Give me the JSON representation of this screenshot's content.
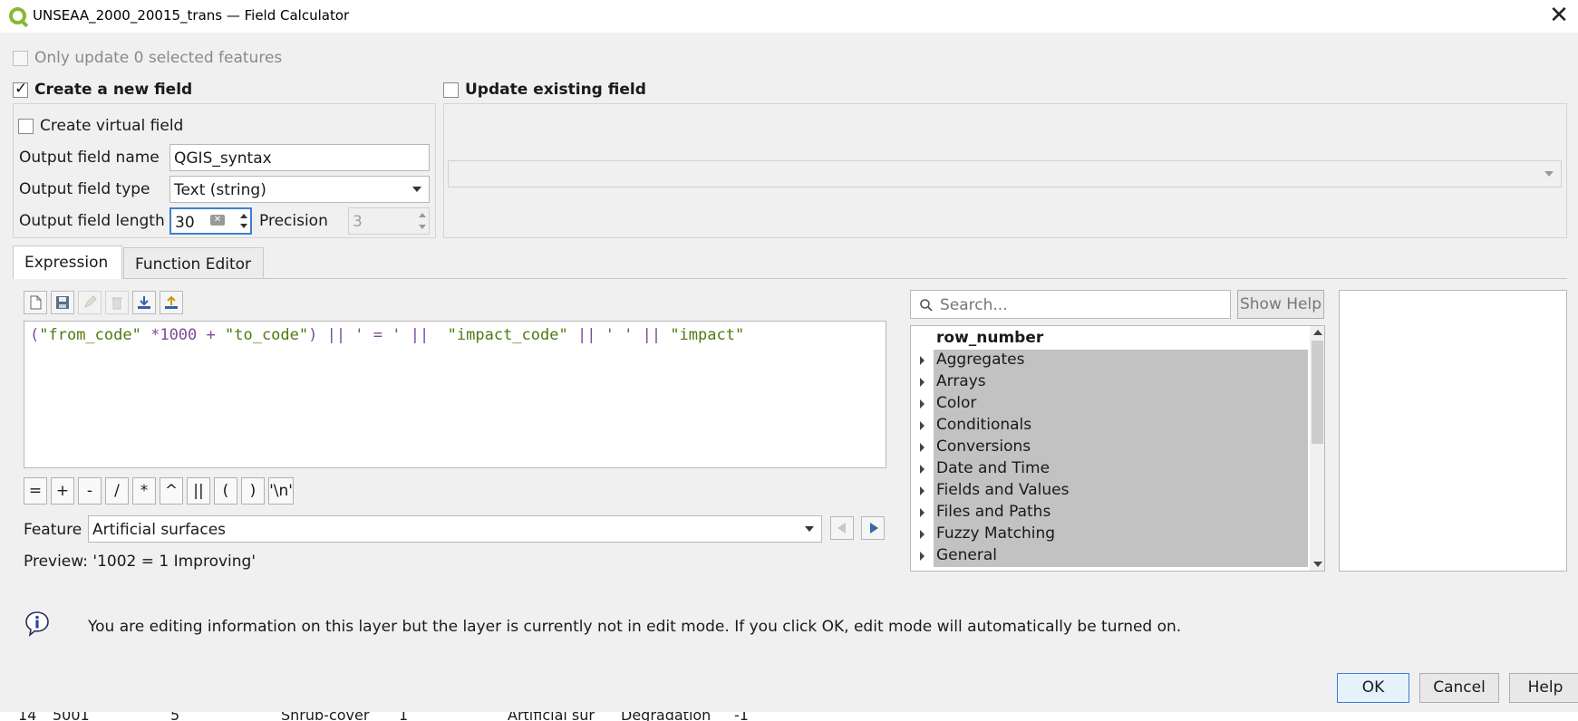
{
  "window": {
    "title": "UNSEAA_2000_20015_trans — Field Calculator",
    "close_glyph": "✕"
  },
  "options": {
    "only_update_label": "Only update 0 selected features",
    "create_new_field_label": "Create a new field",
    "update_existing_label": "Update existing field",
    "create_virtual_label": "Create virtual field"
  },
  "output": {
    "name_label": "Output field name",
    "name_value": "QGIS_syntax",
    "type_label": "Output field type",
    "type_value": "Text (string)",
    "length_label": "Output field length",
    "length_value": "30",
    "precision_label": "Precision",
    "precision_value": "3"
  },
  "tabs": {
    "expression": "Expression",
    "function_editor": "Function Editor"
  },
  "expression": {
    "tokens": [
      {
        "t": "(",
        "c": "#7f4a97"
      },
      {
        "t": "\"from_code\"",
        "c": "#4e7a12"
      },
      {
        "t": " *",
        "c": "#7f4a97"
      },
      {
        "t": "1000",
        "c": "#7f4a97"
      },
      {
        "t": " + ",
        "c": "#7f4a97"
      },
      {
        "t": "\"to_code\"",
        "c": "#4e7a12"
      },
      {
        "t": ") || ' = ' ||  ",
        "c": "#7f4a97"
      },
      {
        "t": "\"impact_code\"",
        "c": "#4e7a12"
      },
      {
        "t": " || ' ' || ",
        "c": "#7f4a97"
      },
      {
        "t": "\"impact\"",
        "c": "#4e7a12"
      }
    ]
  },
  "operators": [
    "=",
    "+",
    "-",
    "/",
    "*",
    "^",
    "||",
    "(",
    ")",
    "'\\n'"
  ],
  "feature": {
    "label": "Feature",
    "value": "Artificial surfaces"
  },
  "preview": {
    "label": "Preview:",
    "value": "'1002 = 1 Improving'"
  },
  "search": {
    "placeholder": "Search...",
    "show_help": "Show Help"
  },
  "functions": {
    "first": "row_number",
    "groups": [
      "Aggregates",
      "Arrays",
      "Color",
      "Conditionals",
      "Conversions",
      "Date and Time",
      "Fields and Values",
      "Files and Paths",
      "Fuzzy Matching",
      "General"
    ]
  },
  "message": {
    "text": "You are editing information on this layer but the layer is currently not in edit mode. If you click OK, edit mode will automatically be turned on."
  },
  "buttons": {
    "ok": "OK",
    "cancel": "Cancel",
    "help": "Help"
  },
  "background_table": {
    "cells": [
      "14",
      "5001",
      "5",
      "Shrub-cover",
      "1",
      "Artificial sur",
      "Degradation",
      "-1"
    ]
  },
  "colors": {
    "dialog_bg": "#f0f0f0",
    "accent_blue": "#3c7fd1",
    "tree_group_bg": "#c2c2c2",
    "field_name_green": "#4e7a12",
    "operator_purple": "#7f4a97"
  }
}
